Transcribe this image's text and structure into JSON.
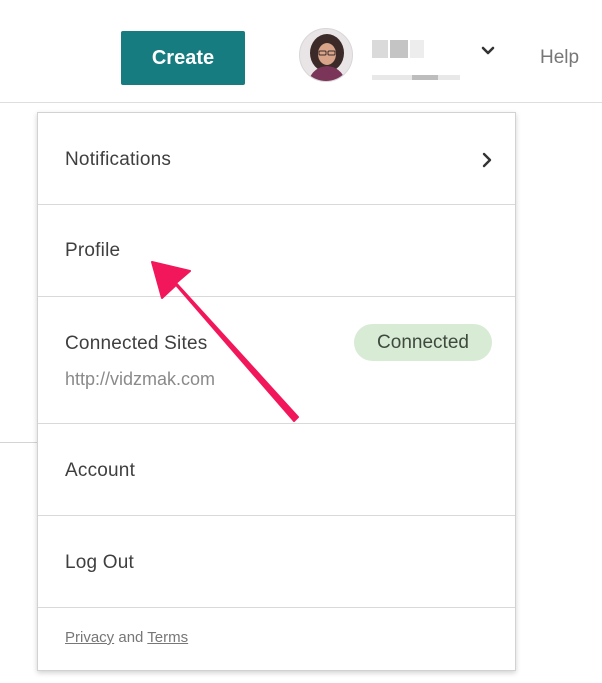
{
  "header": {
    "create_label": "Create",
    "help_label": "Help",
    "accent_color": "#167c80"
  },
  "menu": {
    "notifications_label": "Notifications",
    "profile_label": "Profile",
    "connected_sites_label": "Connected Sites",
    "connected_site_url": "http://vidzmak.com",
    "connected_badge": "Connected",
    "account_label": "Account",
    "logout_label": "Log Out",
    "footer_privacy": "Privacy",
    "footer_and": "and",
    "footer_terms": "Terms"
  },
  "icons": {
    "dropdown": "chevron-down-icon",
    "submenu": "chevron-right-icon",
    "annotation": "arrow-icon"
  },
  "annotation": {
    "arrow_color": "#f2165b"
  }
}
